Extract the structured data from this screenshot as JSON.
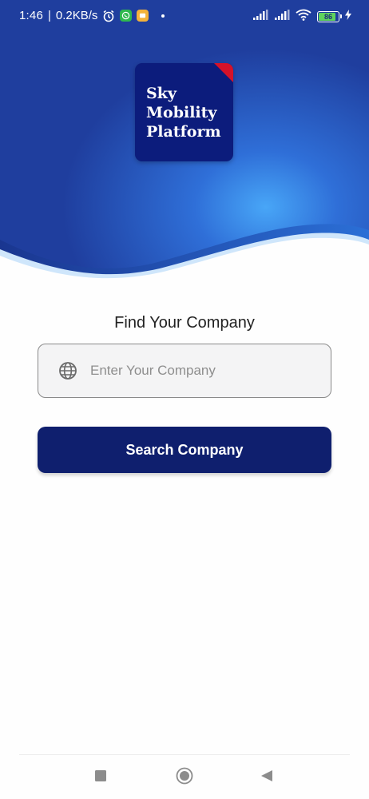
{
  "status_bar": {
    "time": "1:46",
    "network_speed": "0.2KB/s",
    "separator": "|",
    "battery_level": "86",
    "battery_fraction": 0.86,
    "icons": [
      "alarm-icon",
      "whatsapp-icon",
      "message-icon",
      "signal-icon",
      "wifi-icon",
      "battery-icon",
      "charging-icon"
    ]
  },
  "logo": {
    "line1": "Sky",
    "line2": "Mobility",
    "line3": "Platform"
  },
  "form": {
    "title": "Find Your Company",
    "input_placeholder": "Enter Your Company",
    "input_value": "",
    "search_button_label": "Search Company"
  },
  "colors": {
    "hero_dark": "#1f3a9c",
    "hero_light": "#3f9bf2",
    "logo_bg": "#0c1c7c",
    "logo_corner": "#d4122a",
    "button_bg": "#0f1f6e"
  },
  "nav": {
    "icons": [
      "recents-square-icon",
      "home-circle-icon",
      "back-triangle-icon"
    ]
  }
}
